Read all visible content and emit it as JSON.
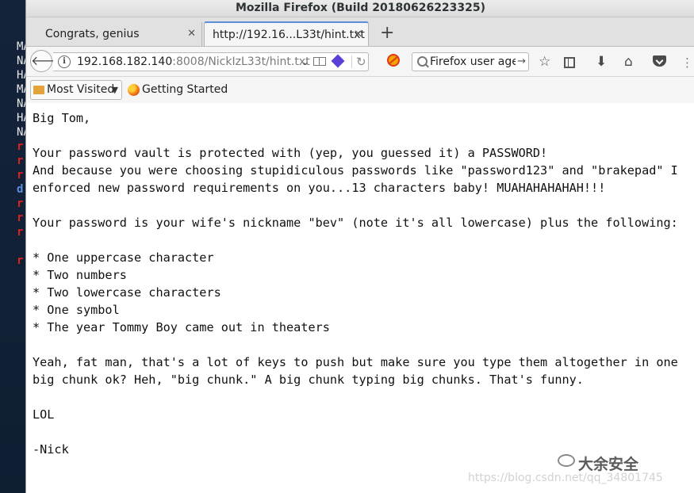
{
  "window": {
    "title": "Mozilla Firefox (Build 20180626223325)"
  },
  "tabs": [
    {
      "label": "Congrats, genius",
      "active": false
    },
    {
      "label": "http://192.16...L33t/hint.txt",
      "active": true
    }
  ],
  "navbar": {
    "url_host": "192.168.182.140",
    "url_rest": ":8008/NickIzL33t/hint.txt",
    "search_value": "Firefox user ager"
  },
  "icons": {
    "back": "back-arrow-icon",
    "info": "info-icon",
    "reader": "reader-view-icon",
    "extension": "extension-icon",
    "reload": "reload-icon",
    "noscript": "noscript-icon",
    "search": "search-icon",
    "bookmark": "star-icon",
    "library": "library-icon",
    "download": "download-icon",
    "home": "home-icon",
    "pocket": "pocket-icon",
    "menu": "menu-icon"
  },
  "bookmarks": {
    "most_visited": "Most Visited",
    "getting_started": "Getting Started"
  },
  "terminal": {
    "lines": [
      {
        "text": "MA",
        "color": "w"
      },
      {
        "text": "NA",
        "color": "w"
      },
      {
        "text": "HA",
        "color": "w"
      },
      {
        "text": "MA",
        "color": "w"
      },
      {
        "text": "NA",
        "color": "w"
      },
      {
        "text": "HA",
        "color": "w"
      },
      {
        "text": "NA",
        "color": "w"
      },
      {
        "text": "r",
        "color": "r"
      },
      {
        "text": "r",
        "color": "r"
      },
      {
        "text": "r",
        "color": "r"
      },
      {
        "text": "d",
        "color": "b"
      },
      {
        "text": "r",
        "color": "r"
      },
      {
        "text": "r",
        "color": "r"
      },
      {
        "text": "r",
        "color": "r"
      },
      {
        "text": "",
        "color": "w"
      },
      {
        "text": "r",
        "color": "r"
      }
    ]
  },
  "document": {
    "text": "Big Tom,\n\nYour password vault is protected with (yep, you guessed it) a PASSWORD!\nAnd because you were choosing stupidiculous passwords like \"password123\" and \"brakepad\" I\nenforced new password requirements on you...13 characters baby! MUAHAHAHAHAH!!!\n\nYour password is your wife's nickname \"bev\" (note it's all lowercase) plus the following:\n\n* One uppercase character\n* Two numbers\n* Two lowercase characters\n* One symbol\n* The year Tommy Boy came out in theaters\n\nYeah, fat man, that's a lot of keys to push but make sure you type them altogether in one\nbig chunk ok? Heh, \"big chunk.\" A big chunk typing big chunks. That's funny.\n\nLOL\n\n-Nick"
  },
  "overlay": {
    "watermark": "大余安全",
    "csdn": "https://blog.csdn.net/qq_34801745"
  }
}
